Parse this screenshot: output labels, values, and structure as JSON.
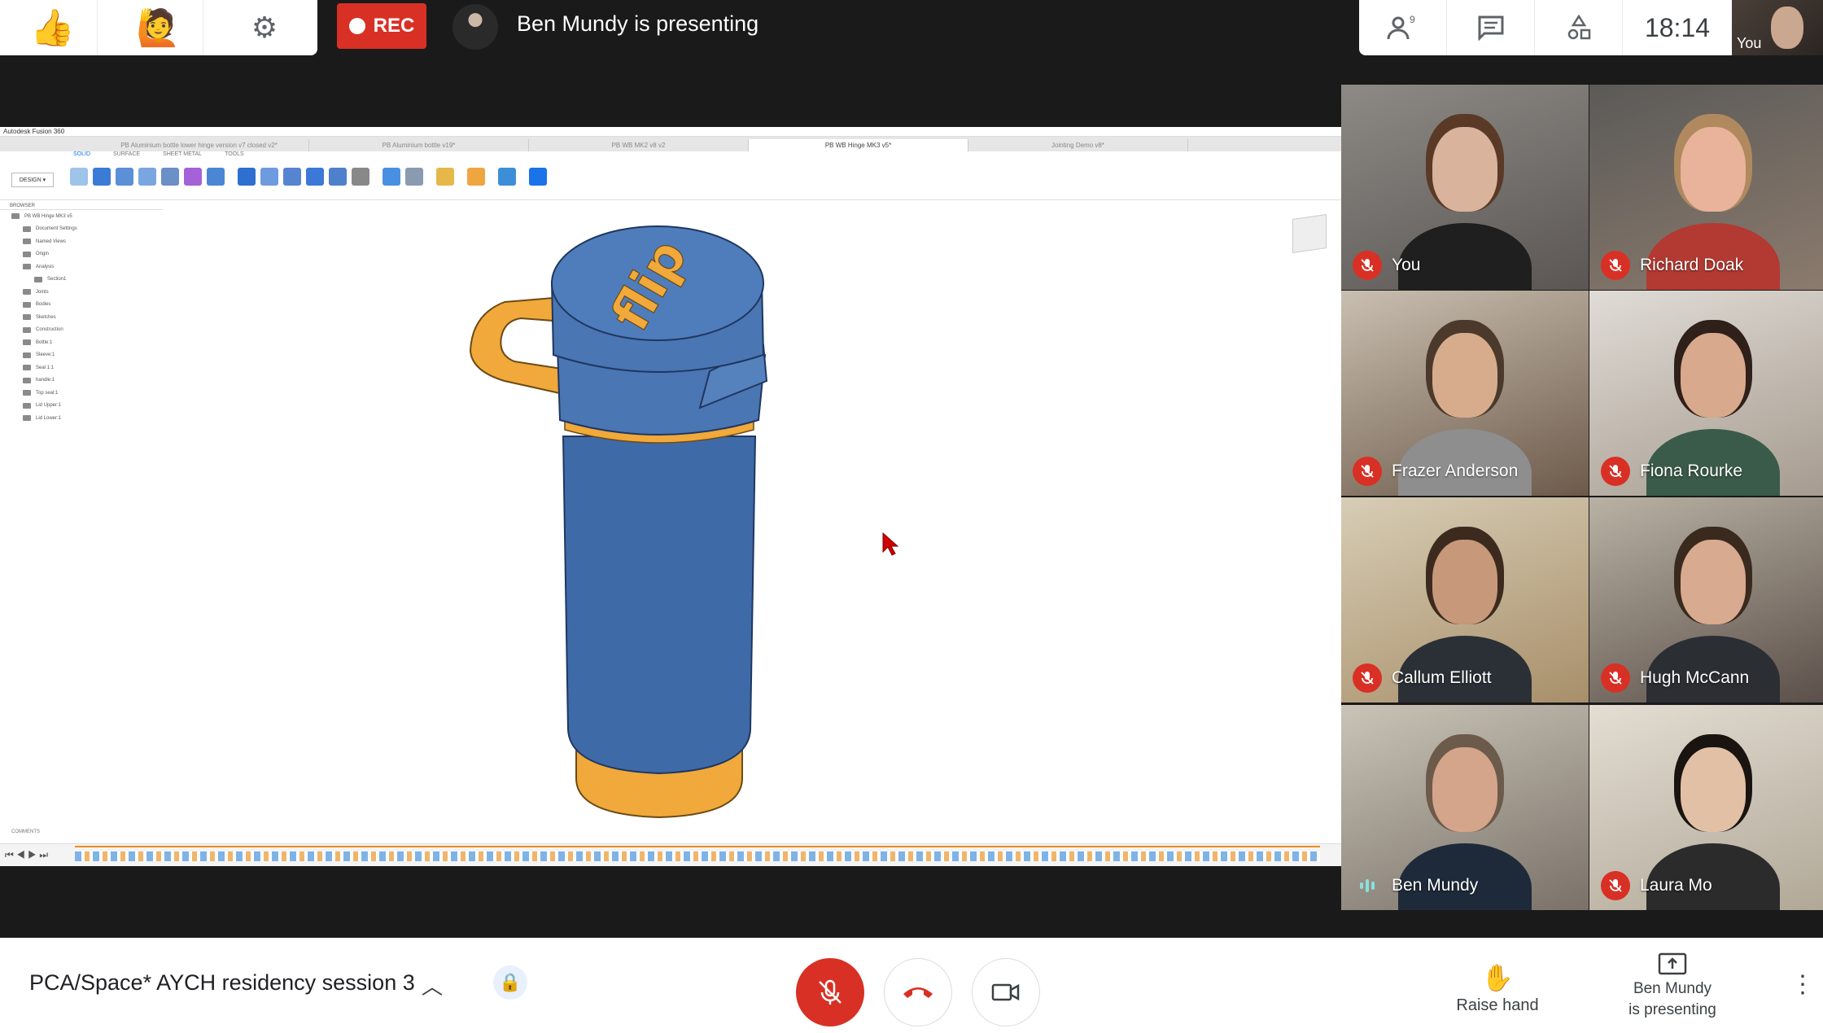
{
  "top": {
    "reaction_icons": [
      "👍",
      "🙋",
      "⚙"
    ],
    "rec_label": "REC",
    "presenting": "Ben Mundy is presenting",
    "clock": "18:14",
    "people_count": "9",
    "self_label": "You"
  },
  "screen": {
    "window_title": "Autodesk Fusion 360",
    "tabs": [
      "PB Aluminium bottle lower hinge version v7 closed v2*",
      "PB Aluminium bottle v19*",
      "PB WB MK2 v8 v2",
      "PB WB Hinge MK3 v5*",
      "Jointing Demo v8*"
    ],
    "toolbar_tabs": [
      "SOLID",
      "SURFACE",
      "SHEET METAL",
      "TOOLS"
    ],
    "design_dropdown": "DESIGN ▾",
    "browser_header": "BROWSER",
    "browser_items": [
      "PB WB Hinge MK3 v5",
      "Document Settings",
      "Named Views",
      "Origin",
      "Analysis",
      "Section1",
      "Joints",
      "Bodies",
      "Sketches",
      "Construction",
      "Bottle:1",
      "Sleeve:1",
      "Seal 1:1",
      "handle:1",
      "Top seal:1",
      "Lid Upper:1",
      "Lid Lower:1"
    ],
    "lid_text": "flip",
    "comments": "COMMENTS"
  },
  "participants": [
    {
      "name": "You",
      "muted": true
    },
    {
      "name": "Richard Doak",
      "muted": true
    },
    {
      "name": "Frazer Anderson",
      "muted": true
    },
    {
      "name": "Fiona Rourke",
      "muted": true
    },
    {
      "name": "Callum Elliott",
      "muted": true
    },
    {
      "name": "Hugh McCann",
      "muted": true
    },
    {
      "name": "Ben Mundy",
      "muted": false
    },
    {
      "name": "Laura Mo",
      "muted": true
    }
  ],
  "bottom": {
    "meeting_title": "PCA/Space* AYCH residency session 3",
    "raise_hand": "Raise hand",
    "present_line1": "Ben Mundy",
    "present_line2": "is presenting"
  },
  "colors": {
    "danger": "#d93025",
    "bottle_blue": "#3f6aa8",
    "bottle_orange": "#f0a93a",
    "speaking": "#8ae0dc"
  }
}
